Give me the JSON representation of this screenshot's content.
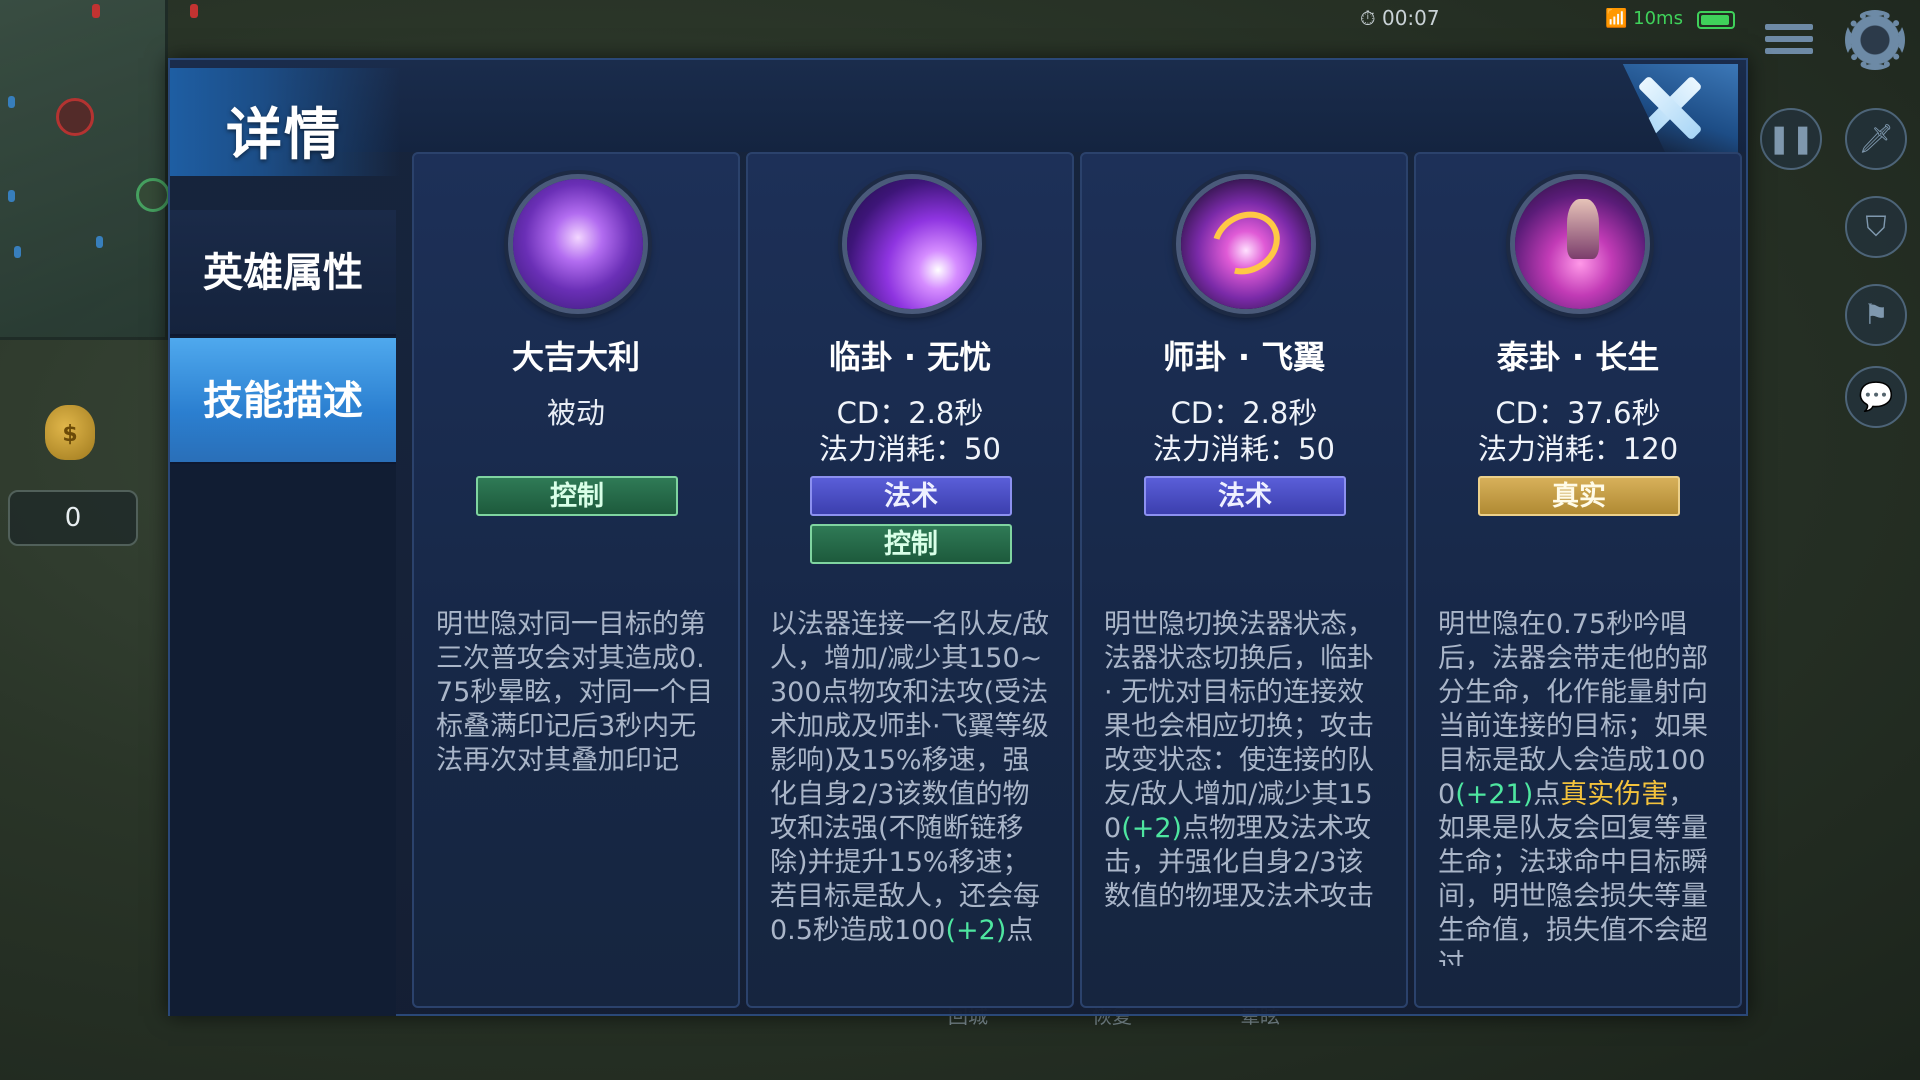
{
  "hud": {
    "timer": "00:07",
    "ping": "10ms",
    "gold_count": "0",
    "bottom_labels": [
      "回城",
      "恢复",
      "晕眩"
    ]
  },
  "dialog": {
    "title": "详情",
    "nav": [
      {
        "label": "英雄属性",
        "active": false
      },
      {
        "label": "技能描述",
        "active": true
      }
    ]
  },
  "skills": [
    {
      "name": "大吉大利",
      "sub": "被动",
      "tags": [
        {
          "label": "控制",
          "color": "green"
        }
      ],
      "description": "明世隐对同一目标的第三次普攻会对其造成0.75秒晕眩，对同一个目标叠满印记后3秒内无法再次对其叠加印记"
    },
    {
      "name": "临卦 · 无忧",
      "cd": "CD：2.8秒",
      "mana": "法力消耗：50",
      "tags": [
        {
          "label": "法术",
          "color": "purple"
        },
        {
          "label": "控制",
          "color": "green"
        }
      ],
      "description_parts": [
        {
          "text": "以法器连接一名队友/敌人，增加/减少其150~300点物攻和法攻(受法术加成及师卦·飞翼等级影响)及15%移速，强化自身2/3该数值的物攻和法强(不随断链移除)并提升15%移速；若目标是敌人，还会每0.5秒造成100",
          "hl": ""
        },
        {
          "text": "(+2)",
          "hl": "g"
        },
        {
          "text": "点",
          "hl": ""
        }
      ]
    },
    {
      "name": "师卦 · 飞翼",
      "cd": "CD：2.8秒",
      "mana": "法力消耗：50",
      "tags": [
        {
          "label": "法术",
          "color": "purple"
        }
      ],
      "description_parts": [
        {
          "text": "明世隐切换法器状态，法器状态切换后，临卦 · 无忧对目标的连接效果也会相应切换；攻击改变状态：使连接的队友/敌人增加/减少其150",
          "hl": ""
        },
        {
          "text": "(+2)",
          "hl": "g"
        },
        {
          "text": "点物理及法术攻击，并强化自身2/3该数值的物理及法术攻击",
          "hl": ""
        }
      ]
    },
    {
      "name": "泰卦 · 长生",
      "cd": "CD：37.6秒",
      "mana": "法力消耗：120",
      "tags": [
        {
          "label": "真实",
          "color": "gold"
        }
      ],
      "description_parts": [
        {
          "text": "明世隐在0.75秒吟唱后，法器会带走他的部分生命，化作能量射向当前连接的目标；如果目标是敌人会造成1000",
          "hl": ""
        },
        {
          "text": "(+21)",
          "hl": "g"
        },
        {
          "text": "点",
          "hl": ""
        },
        {
          "text": "真实伤害",
          "hl": "y"
        },
        {
          "text": "，如果是队友会回复等量生命；法球命中目标瞬间，明世隐会损失等量生命值，损失值不会超过",
          "hl": ""
        }
      ]
    }
  ]
}
